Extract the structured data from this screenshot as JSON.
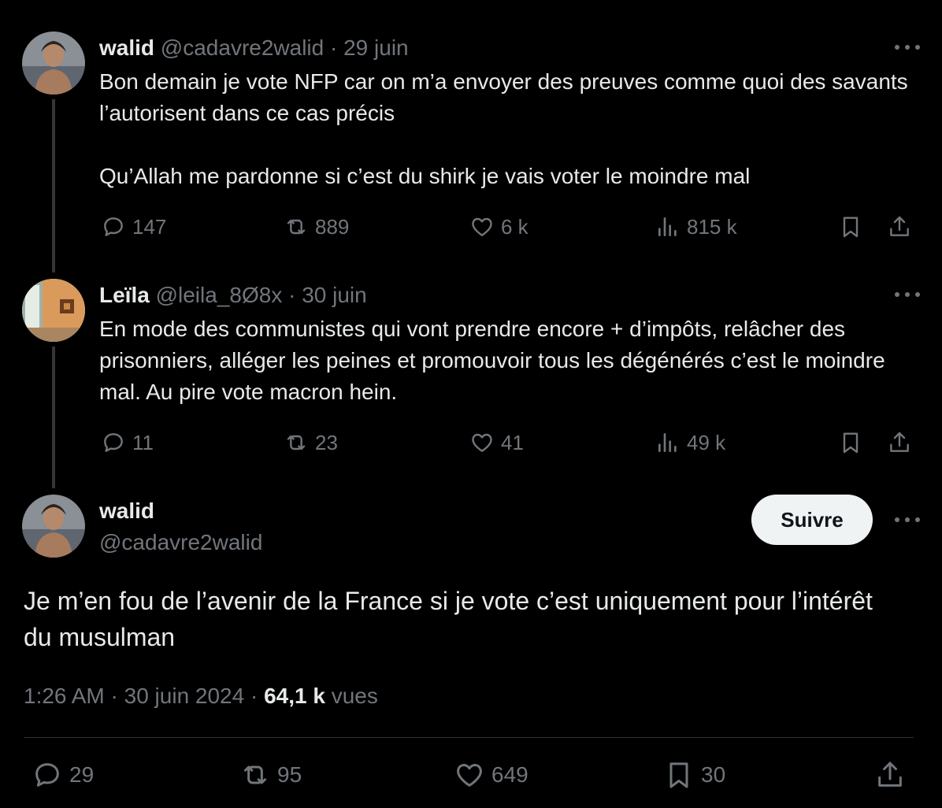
{
  "thread": [
    {
      "display_name": "walid",
      "handle": "@cadavre2walid",
      "separator": " · ",
      "date": "29 juin",
      "text_lines": [
        "Bon demain je vote NFP car on m’a envoyer des preuves comme quoi des savants l’autorisent dans ce cas précis",
        "Qu’Allah me pardonne si c’est du shirk je vais voter le moindre mal"
      ],
      "replies": "147",
      "reposts": "889",
      "likes": "6 k",
      "views": "815 k"
    },
    {
      "display_name": "Leïla",
      "handle": "@leila_8Ø8x",
      "separator": " · ",
      "date": "30 juin",
      "text_lines": [
        "En mode des communistes qui vont prendre encore + d’impôts, relâcher des prisonniers, alléger les peines et promouvoir tous les dégénérés c’est le moindre mal. Au pire vote macron hein."
      ],
      "replies": "11",
      "reposts": "23",
      "likes": "41",
      "views": "49 k"
    }
  ],
  "main_tweet": {
    "display_name": "walid",
    "handle": "@cadavre2walid",
    "follow_label": "Suivre",
    "text": "Je m’en fou de l’avenir de la France si je vote c’est uniquement pour l’intérêt du musulman",
    "time": "1:26 AM",
    "separator": " · ",
    "date": "30 juin 2024",
    "views_count": "64,1 k",
    "views_label": " vues",
    "replies": "29",
    "reposts": "95",
    "likes": "649",
    "bookmarks": "30"
  },
  "icons": {
    "reply": "reply-icon",
    "repost": "repost-icon",
    "like": "heart-icon",
    "views": "views-icon",
    "bookmark": "bookmark-icon",
    "share": "share-icon",
    "more": "more-icon"
  },
  "colors": {
    "background": "#000000",
    "text": "#e7e9ea",
    "secondary": "#71767b",
    "button_bg": "#eff3f4"
  }
}
